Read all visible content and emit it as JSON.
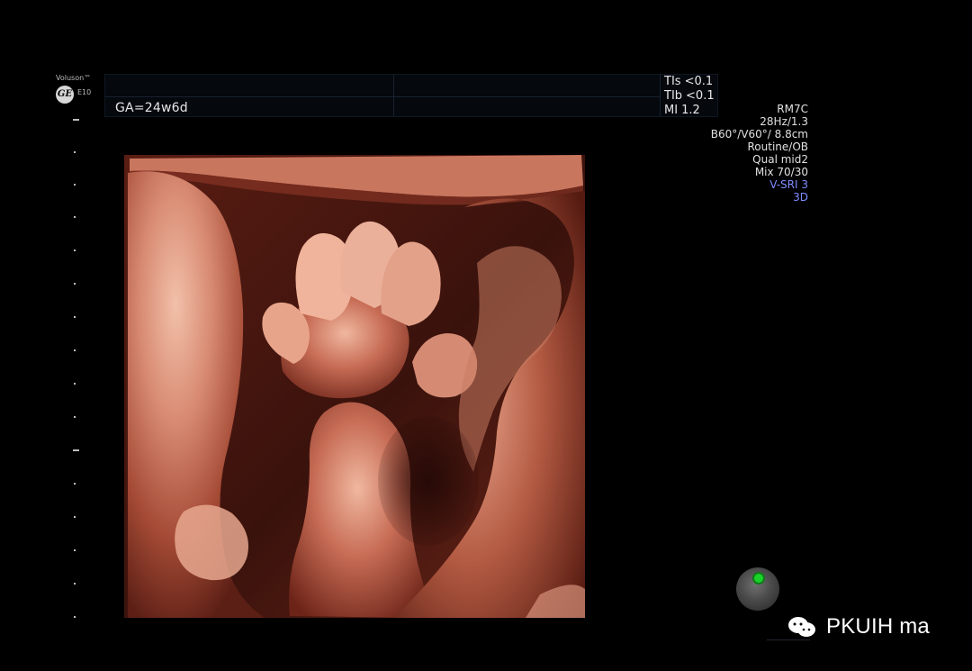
{
  "device": {
    "brand": "Voluson™",
    "model": "E10",
    "logo_text": "GE"
  },
  "header": {
    "ga": "GA=24w6d",
    "tis_label": "TIs",
    "tis_value": "<0.1",
    "tib_label": "TIb",
    "tib_value": "<0.1",
    "mi_label": "MI",
    "mi_value": "1.2"
  },
  "parameters": [
    "RM7C",
    "28Hz/1.3",
    "B60°/V60°/ 8.8cm",
    "Routine/OB",
    "Qual mid2",
    "Mix 70/30",
    "V-SRI 3",
    "3D"
  ],
  "colors": {
    "tissue_light": "#e6a78e",
    "tissue_mid": "#b05a43",
    "tissue_dark": "#4a170f",
    "accent_blue": "#7f8cff",
    "marker_green": "#19d229"
  },
  "watermark": {
    "text": "PKUIH ma",
    "icon": "chat-bubbles-icon"
  },
  "icons": {
    "orientation": "orientation-marker-icon"
  }
}
